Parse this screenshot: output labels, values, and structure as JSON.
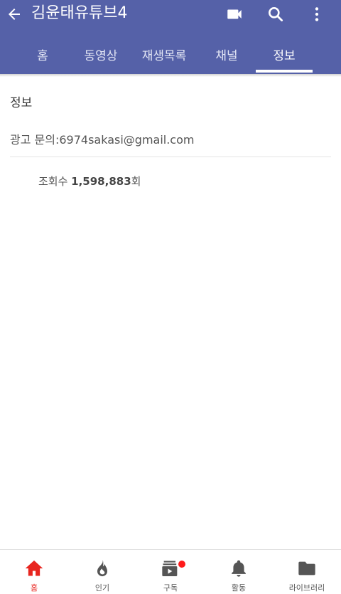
{
  "header": {
    "channel_title": "김윤태유튜브4",
    "icons": {
      "back": "arrow-left-icon",
      "camera": "video-camera-icon",
      "search": "search-icon",
      "more": "more-vertical-icon"
    }
  },
  "tabs": [
    {
      "label": "홈",
      "active": false
    },
    {
      "label": "동영상",
      "active": false
    },
    {
      "label": "재생목록",
      "active": false
    },
    {
      "label": "채널",
      "active": false
    },
    {
      "label": "정보",
      "active": true
    }
  ],
  "about": {
    "title": "정보",
    "description": "광고 문의:6974sakasi@gmail.com",
    "views_prefix": "조회수 ",
    "views_count": "1,598,883",
    "views_suffix": "회"
  },
  "bottom_nav": [
    {
      "label": "홈",
      "icon": "home-icon",
      "active": true
    },
    {
      "label": "인기",
      "icon": "trending-flame-icon",
      "active": false
    },
    {
      "label": "구독",
      "icon": "subscriptions-icon",
      "active": false,
      "badge": true
    },
    {
      "label": "활동",
      "icon": "bell-icon",
      "active": false
    },
    {
      "label": "라이브러리",
      "icon": "folder-icon",
      "active": false
    }
  ],
  "colors": {
    "header_bg": "#5561a8",
    "active_nav": "#e8251f",
    "badge": "#ff1a1a",
    "icon_gray": "#555555"
  }
}
